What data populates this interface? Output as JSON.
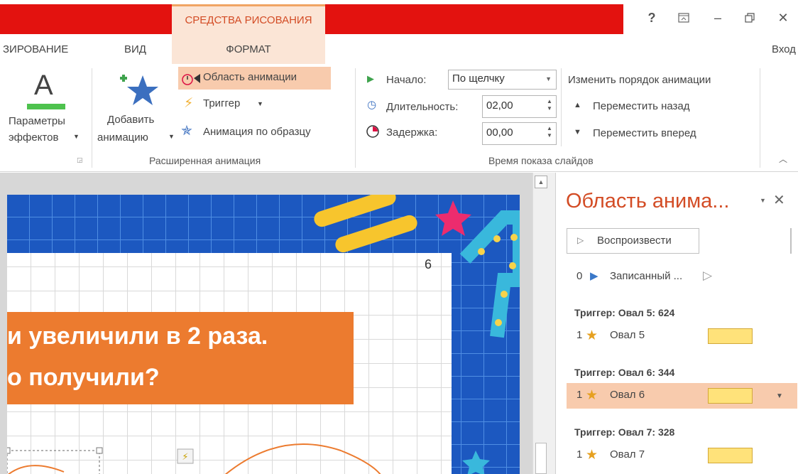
{
  "titlebar": {
    "context_tab": "СРЕДСТВА РИСОВАНИЯ",
    "help": "?",
    "minimize": "–",
    "close": "✕"
  },
  "tabs": {
    "animation_partial": "ЗИРОВАНИЕ",
    "view": "ВИД",
    "format": "ФОРМАТ",
    "signin_partial": "Вход"
  },
  "ribbon": {
    "effects": {
      "icon_letter": "A",
      "line1": "Параметры",
      "line2": "эффектов"
    },
    "add_animation": {
      "line1": "Добавить",
      "line2": "анимацию"
    },
    "animation_pane_btn": "Область анимации",
    "trigger_btn": "Триггер",
    "painter_btn": "Анимация по образцу",
    "group_advanced": "Расширенная анимация",
    "start_label": "Начало:",
    "start_value": "По щелчку",
    "duration_label": "Длительность:",
    "duration_value": "02,00",
    "delay_label": "Задержка:",
    "delay_value": "00,00",
    "reorder_title": "Изменить порядок анимации",
    "move_back": "Переместить назад",
    "move_forward": "Переместить вперед",
    "group_timing": "Время показа слайдов"
  },
  "slide": {
    "page_number": "6",
    "line1": "и увеличили в 2 раза.",
    "line2": "о получили?"
  },
  "pane": {
    "title": "Область анима...",
    "play_button": "Воспроизвести",
    "recorded_num": "0",
    "recorded_label": "Записанный ...",
    "triggers": [
      {
        "label": "Триггер: Овал 5: 624",
        "num": "1",
        "name": "Овал 5"
      },
      {
        "label": "Триггер: Овал 6: 344",
        "num": "1",
        "name": "Овал 6"
      },
      {
        "label": "Триггер: Овал 7: 328",
        "num": "1",
        "name": "Овал 7"
      }
    ]
  }
}
